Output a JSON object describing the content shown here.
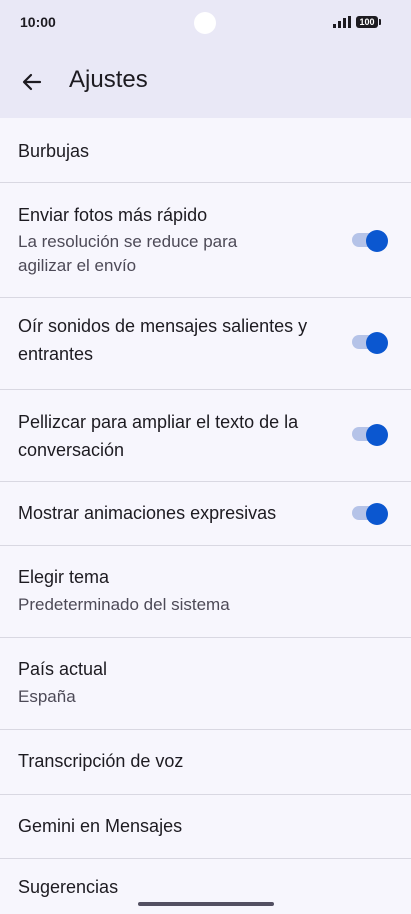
{
  "status_bar": {
    "time": "10:00",
    "battery": "100"
  },
  "header": {
    "title": "Ajustes"
  },
  "settings": [
    {
      "title": "Burbujas"
    },
    {
      "title": "Enviar fotos más rápido",
      "subtitle_line1": "La resolución se reduce para",
      "subtitle_line2": "agilizar el envío",
      "toggle_on": true
    },
    {
      "title_line1": "Oír sonidos de mensajes salientes y",
      "title_line2": "entrantes",
      "toggle_on": true
    },
    {
      "title_line1": "Pellizcar para ampliar el texto de la",
      "title_line2": "conversación",
      "toggle_on": true
    },
    {
      "title": "Mostrar animaciones expresivas",
      "toggle_on": true
    },
    {
      "title": "Elegir tema",
      "subtitle": "Predeterminado del sistema"
    },
    {
      "title": "País actual",
      "subtitle": "España"
    },
    {
      "title": "Transcripción de voz"
    },
    {
      "title": "Gemini en Mensajes"
    },
    {
      "title": "Sugerencias"
    }
  ],
  "colors": {
    "accent": "#0b57d0",
    "toggle_track": "#b5c3e8",
    "header_bg": "#e9e8f6",
    "page_bg": "#f7f6fd"
  },
  "icons": {
    "back": "arrow-left-icon",
    "signal": "signal-icon",
    "battery": "battery-icon"
  }
}
